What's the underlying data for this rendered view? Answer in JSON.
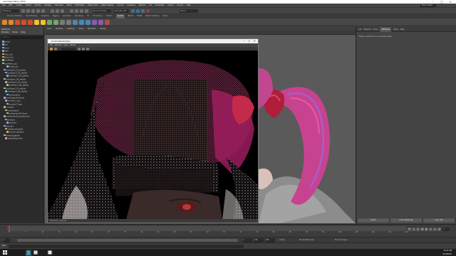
{
  "window": {
    "title": "Autodesk Maya 2019"
  },
  "menubar": {
    "items": [
      "File",
      "Edit",
      "Create",
      "Select",
      "Modify",
      "Display",
      "Windows",
      "Mesh",
      "Edit Mesh",
      "Mesh Tools",
      "Mesh Display",
      "Curves",
      "Surfaces",
      "Deform",
      "UV",
      "Generate",
      "Cache",
      "Arnold",
      "Help"
    ],
    "workspace": "Maya Classic"
  },
  "statusline": {
    "mode": "Modeling",
    "field1": "No Live Surface",
    "field2": "Symmetry: Off",
    "field3": "Sign In"
  },
  "shelf": {
    "tabs": [
      "Curves / Surfaces",
      "Poly Modeling",
      "Sculpting",
      "Rigging",
      "Animation",
      "Rendering",
      "FX",
      "FX Caching",
      "Custom",
      "Arnold",
      "Bifrost",
      "MASH",
      "Motion Graphics",
      "XGen"
    ],
    "active": "Arnold"
  },
  "outliner": {
    "title": "Outliner",
    "menus": [
      "Display",
      "Show",
      "Help"
    ],
    "search_placeholder": "Search...",
    "items": [
      "persp",
      "top",
      "front",
      "side",
      "Hair_Grp",
      "Body_Grp",
      "FaceMesh",
      "HairMesh_grp",
      "Bangs_grp",
      "hairStrand_01_pfxHair",
      "hairStrand_02_pfxHair",
      "hairStrand_03_pfxHair",
      "hairStrand_04_pfxHair",
      "hairStrand_05_pfxHair",
      "hairStrand_06_pfxHair",
      "hairStrand_07_pfxHair",
      "hairStrand_08_pfxHair",
      "hairSystem1",
      "hairSystem1Follicles",
      "ponytail_L_grp",
      "ponytail_R_grp",
      "nucleus1",
      "hairSystem2",
      "hairSystem2Follicles",
      "hairSystem2OutputCurves",
      "pfxHair1",
      "pfxHair2",
      "pfxHair3",
      "aiSkyDomeLight1",
      "directionalLight1",
      "defaultLightSet",
      "defaultObjectSet"
    ]
  },
  "viewport": {
    "menus": [
      "View",
      "Shading",
      "Lighting",
      "Show",
      "Renderer",
      "Panels"
    ]
  },
  "renderview": {
    "title": "Arnold RenderView",
    "menus": [
      "File",
      "Window",
      "View",
      "Render"
    ],
    "status": "00:00:05 | 1 sample"
  },
  "attribute_editor": {
    "tabs": [
      "List",
      "Selected",
      "Focus",
      "Attributes",
      "Show",
      "Help"
    ],
    "active_tab": "Attributes",
    "message": "Make a selection to view attributes.",
    "buttons": [
      "Select",
      "Load Attributes",
      "Copy Tab"
    ]
  },
  "timeline": {
    "ticks": [
      "1",
      "5",
      "10",
      "15",
      "20",
      "25",
      "30",
      "35",
      "40",
      "45",
      "50",
      "55",
      "60",
      "65",
      "70",
      "75",
      "80",
      "85",
      "90",
      "95",
      "100",
      "105",
      "110",
      "115",
      "120"
    ],
    "current_frame": "1"
  },
  "rangebar": {
    "start": "1",
    "range_start": "1",
    "range_end": "120",
    "end": "200",
    "char_set": "No Character Set",
    "anim_layer": "No Anim Layer",
    "fps": "24 fps"
  },
  "commandline": {
    "label": "MEL"
  },
  "taskbar": {
    "time": "12:31 PM",
    "date": "5/14/2019"
  },
  "colors": {
    "hair_magenta": "#d23a8e",
    "hair_pink": "#e04c9a",
    "accent_red": "#c8322e",
    "selection_blue": "#5285a6"
  }
}
